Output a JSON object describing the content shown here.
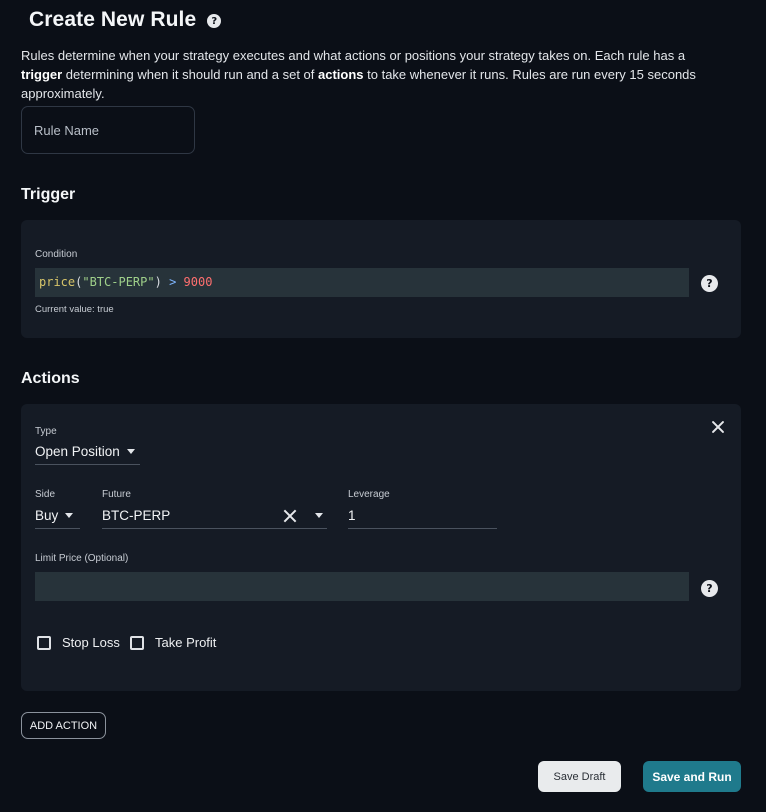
{
  "header": {
    "title": "Create New Rule",
    "help_icon": "help-circle-icon",
    "description_part1": "Rules determine when your strategy executes and what actions or positions your strategy takes on. Each rule has a ",
    "description_bold1": "trigger",
    "description_part2": " determining when it should run and a set of ",
    "description_bold2": "actions",
    "description_part3": " to take whenever it runs. Rules are run every 15 seconds approximately."
  },
  "rule_name": {
    "placeholder": "Rule Name",
    "value": ""
  },
  "trigger": {
    "heading": "Trigger",
    "condition_label": "Condition",
    "condition_tokens": {
      "fn": "price",
      "open": "(",
      "arg": "\"BTC-PERP\"",
      "close": ")",
      "op": " > ",
      "num": "9000"
    },
    "current_value": "Current value: true"
  },
  "actions": {
    "heading": "Actions",
    "items": [
      {
        "type_label": "Type",
        "type_value": "Open Position",
        "side_label": "Side",
        "side_value": "Buy",
        "future_label": "Future",
        "future_value": "BTC-PERP",
        "leverage_label": "Leverage",
        "leverage_value": "1",
        "limit_price_label": "Limit Price (Optional)",
        "limit_price_value": "",
        "stop_loss_label": "Stop Loss",
        "stop_loss_checked": false,
        "take_profit_label": "Take Profit",
        "take_profit_checked": false
      }
    ],
    "add_action_label": "ADD ACTION"
  },
  "footer": {
    "save_draft_label": "Save Draft",
    "save_and_run_label": "Save and Run"
  },
  "colors": {
    "background": "#0b0f17",
    "panel": "#151b25",
    "code_bg": "#27333a",
    "primary_button": "#1f7a8c",
    "secondary_button": "#e9ebed"
  }
}
